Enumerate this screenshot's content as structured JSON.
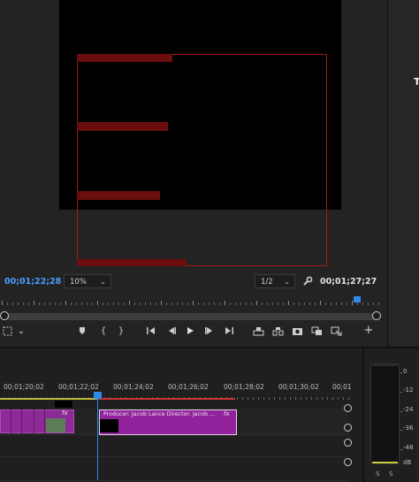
{
  "program_monitor": {
    "current_timecode": "00;01;22;28",
    "duration_timecode": "00;01;27;27",
    "zoom_level": "10%",
    "resolution": "1/2",
    "playhead_fraction": 0.94
  },
  "transport": {
    "icons": [
      "marker-icon",
      "mark-in-icon",
      "mark-out-icon",
      "go-to-in-icon",
      "step-back-icon",
      "play-icon",
      "step-forward-icon",
      "go-to-out-icon",
      "lift-icon",
      "extract-icon",
      "export-frame-icon",
      "comparison-view-icon",
      "toggle-proxies-icon",
      "add-button-icon"
    ]
  },
  "right_panel": {
    "text_fragment": "T"
  },
  "timeline": {
    "ruler_labels": [
      "00;01;20;02",
      "00;01;22;02",
      "00;01;24;02",
      "00;01;26;02",
      "00;01;28;02",
      "00;01;30;02",
      "00;01"
    ],
    "clip_main_label": "Producer: Jacob Lance Director: Jacob ...",
    "fx_label": "fx"
  },
  "audio_meter": {
    "db_labels": [
      "0",
      "-12",
      "-24",
      "-36",
      "-48",
      "dB"
    ],
    "solo_labels": [
      "S",
      "S"
    ]
  },
  "colors": {
    "accent_blue": "#2d8ceb",
    "clip_purple": "#93239d",
    "safe_margin_red": "#a01a1a"
  }
}
